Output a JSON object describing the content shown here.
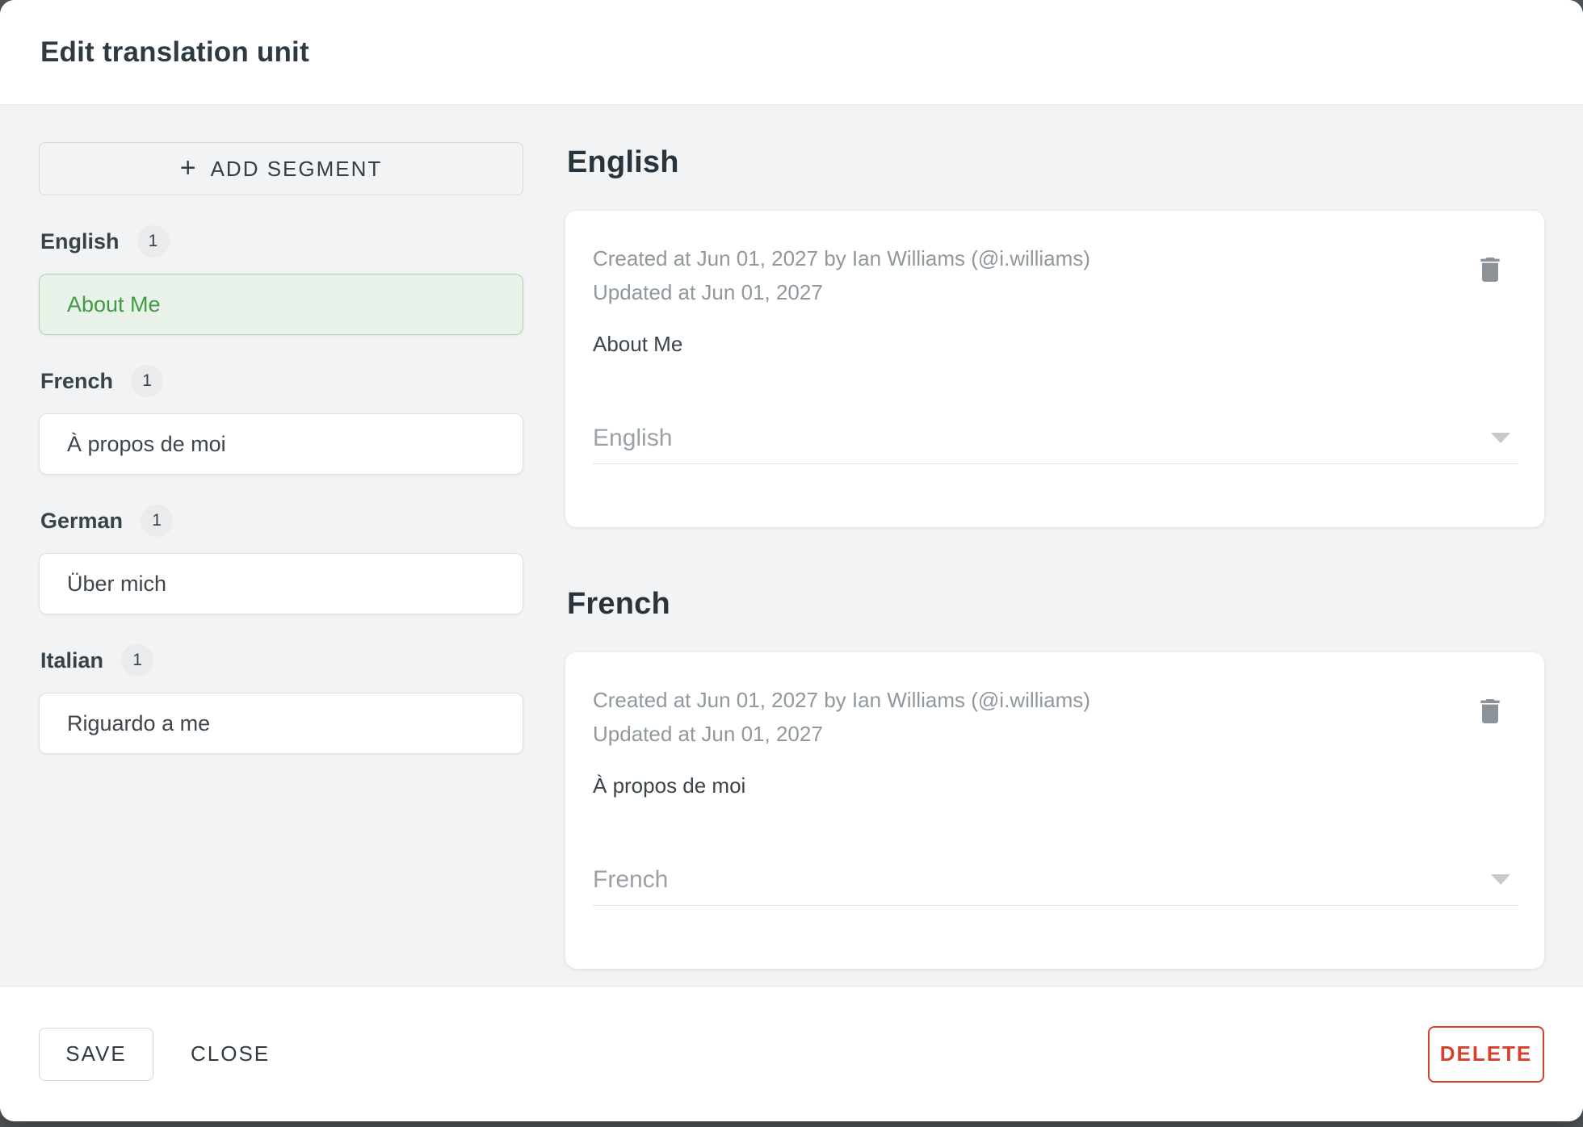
{
  "title": "Edit translation unit",
  "sidebar": {
    "add_segment_label": "ADD SEGMENT",
    "plus": "+",
    "groups": [
      {
        "language": "English",
        "count": "1",
        "text": "About Me",
        "active": true
      },
      {
        "language": "French",
        "count": "1",
        "text": "À propos de moi",
        "active": false
      },
      {
        "language": "German",
        "count": "1",
        "text": "Über mich",
        "active": false
      },
      {
        "language": "Italian",
        "count": "1",
        "text": "Riguardo a me",
        "active": false
      }
    ]
  },
  "sections": [
    {
      "heading": "English",
      "created": "Created at Jun 01, 2027 by Ian Williams (@i.williams)",
      "updated": "Updated at Jun 01, 2027",
      "text": "About Me",
      "language": "English"
    },
    {
      "heading": "French",
      "created": "Created at Jun 01, 2027 by Ian Williams (@i.williams)",
      "updated": "Updated at Jun 01, 2027",
      "text": "À propos de moi",
      "language": "French"
    }
  ],
  "footer": {
    "save": "SAVE",
    "close": "CLOSE",
    "delete": "DELETE"
  },
  "colors": {
    "accent_green": "#3f9c44",
    "green_bg": "#e8f2e8",
    "green_border": "#b2d5b1",
    "danger_red": "#d5402f"
  }
}
